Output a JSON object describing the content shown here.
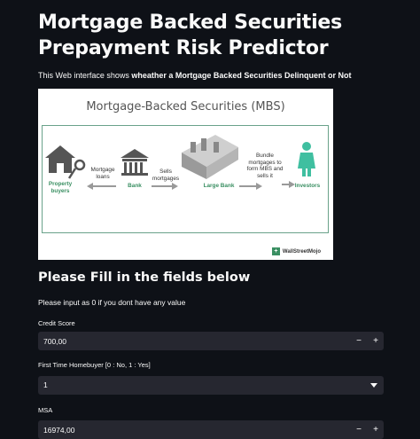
{
  "title": "Mortgage Backed Securities Prepayment Risk Predictor",
  "intro": {
    "prefix": "This Web interface shows ",
    "bold": "wheather a Mortgage Backed Securities Delinquent or Not"
  },
  "figure": {
    "heading": "Mortgage-Backed Securities (MBS)",
    "property_buyers": "Property buyers",
    "mortgage_loans": "Mortgage loans",
    "bank": "Bank",
    "sells_mortgages": "Sells mortgages",
    "large_bank": "Large Bank",
    "bundle": "Bundle mortgages to form MBS and sells it",
    "investors": "Investors",
    "brand": "WallStreetMojo"
  },
  "form": {
    "section_title": "Please Fill in the fields below",
    "hint": "Please input as 0 if you dont have any value",
    "credit_score": {
      "label": "Credit Score",
      "value": "700,00"
    },
    "first_time": {
      "label": "First Time Homebuyer [0 : No, 1 : Yes]",
      "value": "1"
    },
    "msa": {
      "label": "MSA",
      "value": "16974,00"
    },
    "minus": "−",
    "plus": "+"
  }
}
